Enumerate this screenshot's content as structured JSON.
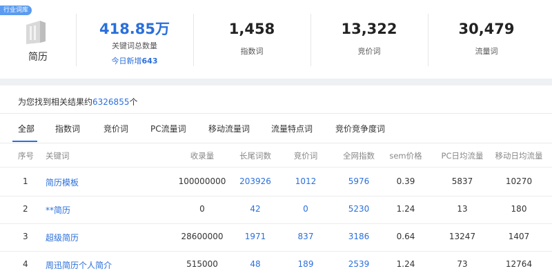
{
  "stats": {
    "tag": "行业词库",
    "category_name": "简历",
    "total": {
      "value": "418.85万",
      "label": "关键词总数量",
      "today_prefix": "今日新增",
      "today_count": "643"
    },
    "index_words": {
      "value": "1,458",
      "label": "指数词"
    },
    "bid_words": {
      "value": "13,322",
      "label": "竞价词"
    },
    "traffic_words": {
      "value": "30,479",
      "label": "流量词"
    }
  },
  "results": {
    "count_prefix": "为您找到相关结果约",
    "count": "6326855",
    "count_suffix": "个",
    "tabs": [
      "全部",
      "指数词",
      "竞价词",
      "PC流量词",
      "移动流量词",
      "流量特点词",
      "竞价竞争度词"
    ],
    "columns": [
      "序号",
      "关键词",
      "收录量",
      "长尾词数",
      "竞价词",
      "全网指数",
      "sem价格",
      "PC日均流量",
      "移动日均流量"
    ],
    "rows": [
      {
        "no": "1",
        "keyword": "简历模板",
        "indexed": "100000000",
        "longtail": "203926",
        "bid": "1012",
        "index": "5976",
        "sem": "0.39",
        "pc": "5837",
        "mobile": "10270"
      },
      {
        "no": "2",
        "keyword": "**简历",
        "indexed": "0",
        "longtail": "42",
        "bid": "0",
        "index": "5230",
        "sem": "1.24",
        "pc": "13",
        "mobile": "180"
      },
      {
        "no": "3",
        "keyword": "超级简历",
        "indexed": "28600000",
        "longtail": "1971",
        "bid": "837",
        "index": "3186",
        "sem": "0.64",
        "pc": "13247",
        "mobile": "1407"
      },
      {
        "no": "4",
        "keyword": "周迅简历个人简介",
        "indexed": "515000",
        "longtail": "48",
        "bid": "189",
        "index": "2539",
        "sem": "1.24",
        "pc": "73",
        "mobile": "12764"
      }
    ]
  }
}
